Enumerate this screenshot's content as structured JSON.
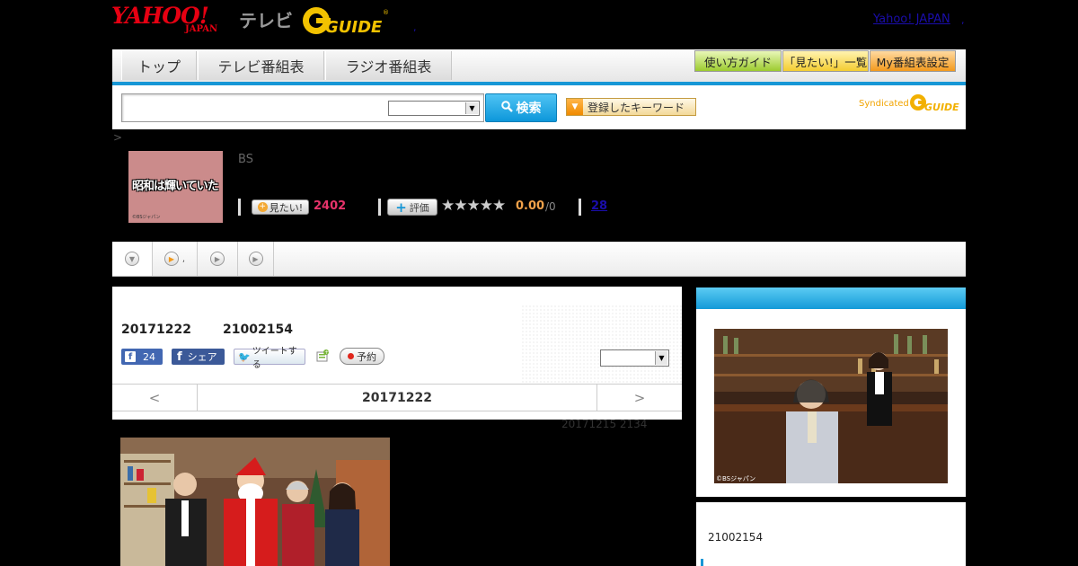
{
  "header": {
    "logo_yahoo": "YAHOO!",
    "logo_japan": "JAPAN",
    "logo_tv": "テレビ",
    "logo_gguide": "G GUIDE",
    "yahoo_japan_link": "Yahoo! JAPAN",
    "dot": ","
  },
  "nav": {
    "tabs": [
      "トップ",
      "テレビ番組表",
      "ラジオ番組表"
    ],
    "buttons": [
      "使い方ガイド",
      "「見たい!」一覧",
      "My番組表設定"
    ]
  },
  "search": {
    "placeholder": "",
    "button_label": "検索",
    "keyword_button_label": "登録したキーワード",
    "syndicated": "Syndicated",
    "syndicated_logo": "GUIDE"
  },
  "breadcrumb": ">",
  "program": {
    "thumbnail_title": "昭和は輝いていた",
    "thumbnail_credit": "©BSジャパン",
    "channel": "BS",
    "mitai_label": "見たい!",
    "mitai_count": "2402",
    "hyoka_label": "評価",
    "stars": "★★★★★",
    "rating_score": "0.00",
    "rating_count": "/0",
    "comment_count": "28",
    "rating_value": 0
  },
  "subtabs": [
    ",",
    ""
  ],
  "episode": {
    "air_date": "20171222",
    "program_id": "21002154",
    "fb_like_count": "24",
    "fb_share_label": "シェア",
    "tweet_label": "ツイートする",
    "reserve_label": "予約",
    "select_value": "",
    "prev_label": "<",
    "next_label": ">",
    "nav_date": "20171222",
    "prev_air": "20171215  2134"
  },
  "sidebar": {
    "photo_credit": "©BSジャパン",
    "program_id": "21002154"
  },
  "colors": {
    "accent_blue": "#1797d6",
    "brand_red": "#e60012",
    "mitai_pink": "#e8336b",
    "rating_orange": "#f2a24a",
    "gguide_yellow": "#f2c200"
  },
  "icons": [
    "search-icon",
    "plus-icon",
    "star-icon",
    "triangle-down-icon",
    "play-icon",
    "facebook-icon",
    "twitter-icon",
    "record-icon"
  ]
}
